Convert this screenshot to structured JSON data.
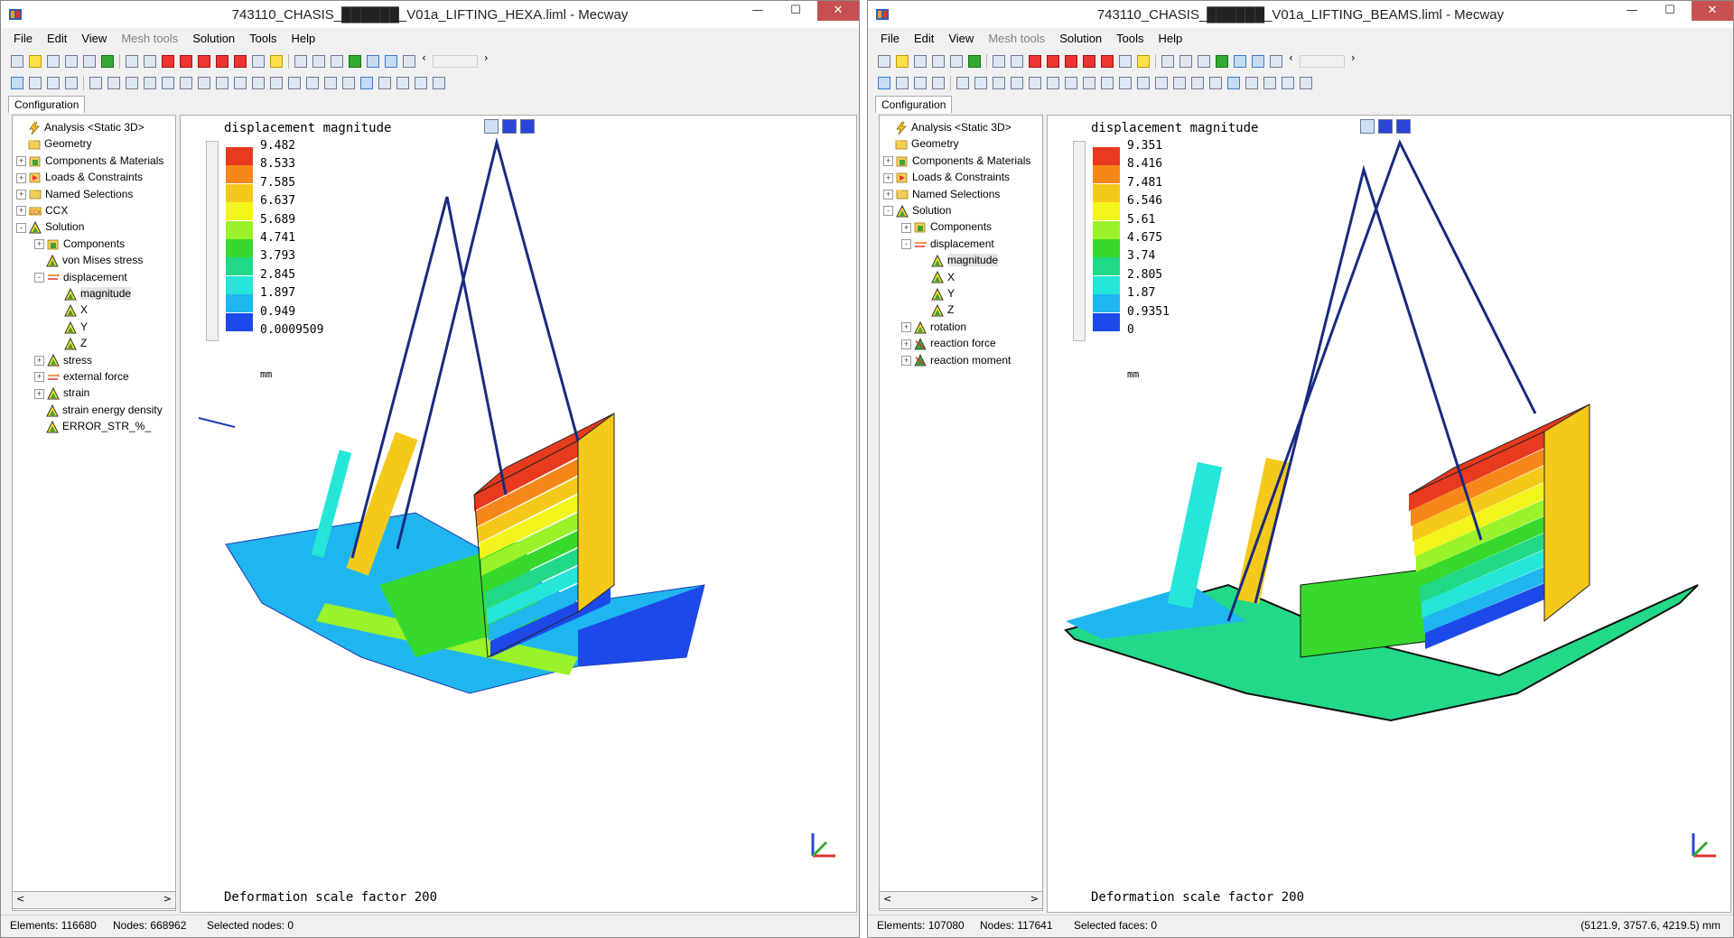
{
  "left_window": {
    "title": "743110_CHASIS_██████_V01a_LIFTING_HEXA.liml - Mecway",
    "menu": [
      {
        "label": "File",
        "disabled": false
      },
      {
        "label": "Edit",
        "disabled": false
      },
      {
        "label": "View",
        "disabled": false
      },
      {
        "label": "Mesh tools",
        "disabled": true
      },
      {
        "label": "Solution",
        "disabled": false
      },
      {
        "label": "Tools",
        "disabled": false
      },
      {
        "label": "Help",
        "disabled": false
      }
    ],
    "tab": "Configuration",
    "tree": [
      {
        "label": "Analysis <Static 3D>",
        "icon": "lightning-icon",
        "indent": 0,
        "expander": ""
      },
      {
        "label": "Geometry",
        "icon": "folder-icon",
        "indent": 0,
        "expander": ""
      },
      {
        "label": "Components & Materials",
        "icon": "component-icon",
        "indent": 0,
        "expander": "+"
      },
      {
        "label": "Loads & Constraints",
        "icon": "load-icon",
        "indent": 0,
        "expander": "+"
      },
      {
        "label": "Named Selections",
        "icon": "folder-icon",
        "indent": 0,
        "expander": "+"
      },
      {
        "label": "CCX",
        "icon": "ccx-icon",
        "indent": 0,
        "expander": "+"
      },
      {
        "label": "Solution",
        "icon": "solution-icon",
        "indent": 0,
        "expander": "-"
      },
      {
        "label": "Components",
        "icon": "component-icon",
        "indent": 1,
        "expander": "+"
      },
      {
        "label": "von Mises stress",
        "icon": "solution-icon",
        "indent": 1,
        "expander": ""
      },
      {
        "label": "displacement",
        "icon": "arrow-icon",
        "indent": 1,
        "expander": "-"
      },
      {
        "label": "magnitude",
        "icon": "solution-icon",
        "indent": 2,
        "expander": "",
        "selected": true
      },
      {
        "label": "X",
        "icon": "solution-icon",
        "indent": 2,
        "expander": ""
      },
      {
        "label": "Y",
        "icon": "solution-icon",
        "indent": 2,
        "expander": ""
      },
      {
        "label": "Z",
        "icon": "solution-icon",
        "indent": 2,
        "expander": ""
      },
      {
        "label": "stress",
        "icon": "solution-icon",
        "indent": 1,
        "expander": "+"
      },
      {
        "label": "external force",
        "icon": "arrow-icon",
        "indent": 1,
        "expander": "+"
      },
      {
        "label": "strain",
        "icon": "solution-icon",
        "indent": 1,
        "expander": "+"
      },
      {
        "label": "strain energy density",
        "icon": "solution-icon",
        "indent": 1,
        "expander": ""
      },
      {
        "label": "ERROR_STR_%_",
        "icon": "solution-icon",
        "indent": 1,
        "expander": ""
      }
    ],
    "viewport": {
      "title": "displacement magnitude",
      "legend_values": [
        "9.482",
        "8.533",
        "7.585",
        "6.637",
        "5.689",
        "4.741",
        "3.793",
        "2.845",
        "1.897",
        "0.949",
        "0.0009509"
      ],
      "unit": "mm",
      "deformation": "Deformation scale factor 200"
    },
    "status": {
      "elements": "Elements: 116680",
      "nodes": "Nodes: 668962",
      "selected": "Selected nodes: 0",
      "coords": ""
    }
  },
  "right_window": {
    "title": "743110_CHASIS_██████_V01a_LIFTING_BEAMS.liml - Mecway",
    "menu": [
      {
        "label": "File",
        "disabled": false
      },
      {
        "label": "Edit",
        "disabled": false
      },
      {
        "label": "View",
        "disabled": false
      },
      {
        "label": "Mesh tools",
        "disabled": true
      },
      {
        "label": "Solution",
        "disabled": false
      },
      {
        "label": "Tools",
        "disabled": false
      },
      {
        "label": "Help",
        "disabled": false
      }
    ],
    "tab": "Configuration",
    "tree": [
      {
        "label": "Analysis <Static 3D>",
        "icon": "lightning-icon",
        "indent": 0,
        "expander": ""
      },
      {
        "label": "Geometry",
        "icon": "folder-icon",
        "indent": 0,
        "expander": ""
      },
      {
        "label": "Components & Materials",
        "icon": "component-icon",
        "indent": 0,
        "expander": "+"
      },
      {
        "label": "Loads & Constraints",
        "icon": "load-icon",
        "indent": 0,
        "expander": "+"
      },
      {
        "label": "Named Selections",
        "icon": "folder-icon",
        "indent": 0,
        "expander": "+"
      },
      {
        "label": "Solution",
        "icon": "solution-icon",
        "indent": 0,
        "expander": "-"
      },
      {
        "label": "Components",
        "icon": "component-icon",
        "indent": 1,
        "expander": "+"
      },
      {
        "label": "displacement",
        "icon": "arrow-icon",
        "indent": 1,
        "expander": "-"
      },
      {
        "label": "magnitude",
        "icon": "solution-icon",
        "indent": 2,
        "expander": "",
        "selected": true
      },
      {
        "label": "X",
        "icon": "solution-icon",
        "indent": 2,
        "expander": ""
      },
      {
        "label": "Y",
        "icon": "solution-icon",
        "indent": 2,
        "expander": ""
      },
      {
        "label": "Z",
        "icon": "solution-icon",
        "indent": 2,
        "expander": ""
      },
      {
        "label": "rotation",
        "icon": "solution-icon",
        "indent": 1,
        "expander": "+"
      },
      {
        "label": "reaction force",
        "icon": "reaction-icon",
        "indent": 1,
        "expander": "+"
      },
      {
        "label": "reaction moment",
        "icon": "reaction-icon",
        "indent": 1,
        "expander": "+"
      }
    ],
    "viewport": {
      "title": "displacement magnitude",
      "legend_values": [
        "9.351",
        "8.416",
        "7.481",
        "6.546",
        "5.61",
        "4.675",
        "3.74",
        "2.805",
        "1.87",
        "0.9351",
        "0"
      ],
      "unit": "mm",
      "deformation": "Deformation scale factor 200"
    },
    "status": {
      "elements": "Elements: 107080",
      "nodes": "Nodes: 117641",
      "selected": "Selected faces: 0",
      "coords": "(5121.9, 3757.6, 4219.5) mm"
    }
  },
  "legend_colors": [
    "#e83a1e",
    "#f7871a",
    "#f5c91a",
    "#f1f51c",
    "#9af22a",
    "#36d92c",
    "#22d987",
    "#25e6d8",
    "#1fb6f0",
    "#1d49e8"
  ],
  "window_controls": {
    "minimize": "—",
    "maximize": "☐",
    "close": "✕"
  },
  "scrollbar": {
    "left": "<",
    "right": ">"
  }
}
